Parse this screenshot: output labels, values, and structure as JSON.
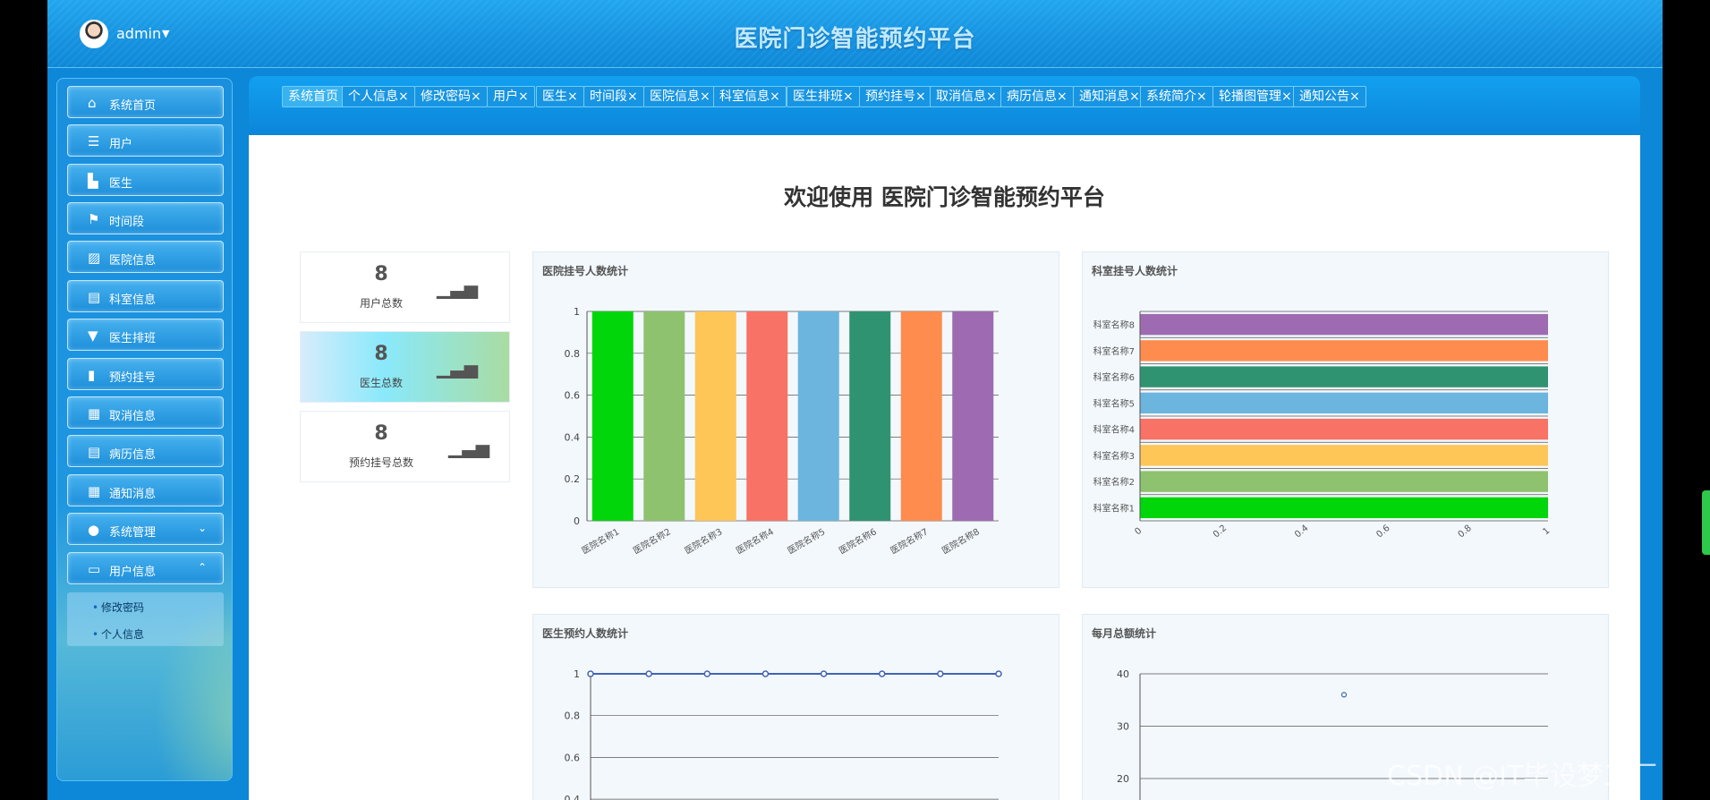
{
  "header": {
    "user": "admin",
    "title": "医院门诊智能预约平台"
  },
  "sidebar": {
    "items": [
      {
        "label": "系统首页",
        "icon": "home-icon",
        "glyph": "⌂"
      },
      {
        "label": "用户",
        "icon": "list-icon",
        "glyph": "☰"
      },
      {
        "label": "医生",
        "icon": "chair-icon",
        "glyph": "▙"
      },
      {
        "label": "时间段",
        "icon": "flag-icon",
        "glyph": "⚑"
      },
      {
        "label": "医院信息",
        "icon": "chart-icon",
        "glyph": "▨"
      },
      {
        "label": "科室信息",
        "icon": "briefcase-icon",
        "glyph": "▤"
      },
      {
        "label": "医生排班",
        "icon": "pin-icon",
        "glyph": "▼"
      },
      {
        "label": "预约挂号",
        "icon": "book-icon",
        "glyph": "▮"
      },
      {
        "label": "取消信息",
        "icon": "grid-icon",
        "glyph": "▦"
      },
      {
        "label": "病历信息",
        "icon": "clipboard-icon",
        "glyph": "▤"
      },
      {
        "label": "通知消息",
        "icon": "grid-icon",
        "glyph": "▦"
      },
      {
        "label": "系统管理",
        "icon": "bulb-icon",
        "glyph": "●"
      },
      {
        "label": "用户信息",
        "icon": "card-icon",
        "glyph": "▭"
      }
    ],
    "submenu": [
      "修改密码",
      "个人信息"
    ]
  },
  "tabs": [
    "系统首页",
    "个人信息",
    "修改密码",
    "用户",
    "医生",
    "时间段",
    "医院信息",
    "科室信息",
    "医生排班",
    "预约挂号",
    "取消信息",
    "病历信息",
    "通知消息",
    "系统简介",
    "轮播图管理",
    "通知公告"
  ],
  "tab_close": "×",
  "welcome": "欢迎使用 医院门诊智能预约平台",
  "stats": [
    {
      "value": "8",
      "label": "用户总数"
    },
    {
      "value": "8",
      "label": "医生总数"
    },
    {
      "value": "8",
      "label": "预约挂号总数"
    }
  ],
  "cards": {
    "hospital": "医院挂号人数统计",
    "dept": "科室挂号人数统计",
    "doctor": "医生预约人数统计",
    "monthly": "每月总额统计"
  },
  "watermark": "CSDN @IT毕设梦工厂",
  "chart_data": [
    {
      "type": "bar",
      "title": "医院挂号人数统计",
      "categories": [
        "医院名称1",
        "医院名称2",
        "医院名称3",
        "医院名称4",
        "医院名称5",
        "医院名称6",
        "医院名称7",
        "医院名称8"
      ],
      "values": [
        1,
        1,
        1,
        1,
        1,
        1,
        1,
        1
      ],
      "colors": [
        "#00d60a",
        "#8fc26f",
        "#fdc657",
        "#f87266",
        "#6bb5df",
        "#2f9371",
        "#fe8c4e",
        "#9e6bb3"
      ],
      "ylim": [
        0,
        1
      ],
      "yticks": [
        "1",
        "0.8",
        "0.6",
        "0.4",
        "0.2",
        "0"
      ]
    },
    {
      "type": "bar",
      "orientation": "horizontal",
      "title": "科室挂号人数统计",
      "categories": [
        "科室名称1",
        "科室名称2",
        "科室名称3",
        "科室名称4",
        "科室名称5",
        "科室名称6",
        "科室名称7",
        "科室名称8"
      ],
      "values": [
        1,
        1,
        1,
        1,
        1,
        1,
        1,
        1
      ],
      "colors": [
        "#00d60a",
        "#8fc26f",
        "#fdc657",
        "#f87266",
        "#6bb5df",
        "#2f9371",
        "#fe8c4e",
        "#9e6bb3"
      ],
      "xlim": [
        0,
        1
      ],
      "xticks": [
        "0",
        "0.2",
        "0.4",
        "0.6",
        "0.8",
        "1"
      ]
    },
    {
      "type": "line",
      "title": "医生预约人数统计",
      "values": [
        1,
        1,
        1,
        1,
        1,
        1,
        1,
        1
      ],
      "ylim": [
        0.4,
        1
      ],
      "yticks": [
        "1",
        "0.8",
        "0.6",
        "0.4"
      ]
    },
    {
      "type": "scatter",
      "title": "每月总额统计",
      "points": [
        {
          "x": 0.5,
          "y": 36
        }
      ],
      "ylim": [
        20,
        40
      ],
      "yticks": [
        "40",
        "30",
        "20"
      ]
    }
  ]
}
